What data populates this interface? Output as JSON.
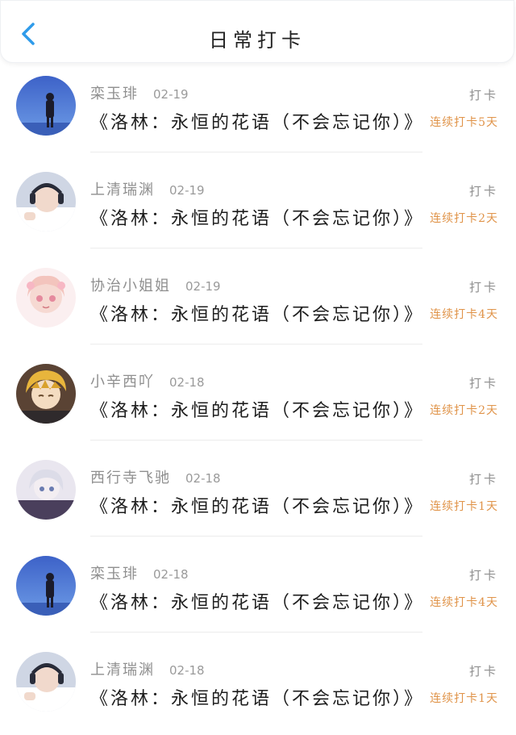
{
  "header": {
    "title": "日常打卡",
    "back_icon": "chevron-left-icon"
  },
  "colors": {
    "accent_blue": "#2f9bea",
    "streak_orange": "#e0944a",
    "muted_text": "#8f8f8f"
  },
  "entries": [
    {
      "username": "栾玉琲",
      "date": "02-19",
      "checkin_label": "打卡",
      "book_title": "《洛林：永恒的花语（不会忘记你）》",
      "streak": "连续打卡5天",
      "avatar": "blue-sky-silhouette-avatar"
    },
    {
      "username": "上清瑞渊",
      "date": "02-19",
      "checkin_label": "打卡",
      "book_title": "《洛林：永恒的花语（不会忘记你）》",
      "streak": "连续打卡2天",
      "avatar": "headphone-boy-avatar"
    },
    {
      "username": "协治小姐姐",
      "date": "02-19",
      "checkin_label": "打卡",
      "book_title": "《洛林：永恒的花语（不会忘记你）》",
      "streak": "连续打卡4天",
      "avatar": "pink-anime-girl-avatar"
    },
    {
      "username": "小辛西吖",
      "date": "02-18",
      "checkin_label": "打卡",
      "book_title": "《洛林：永恒的花语（不会忘记你）》",
      "streak": "连续打卡2天",
      "avatar": "blonde-anime-boy-avatar"
    },
    {
      "username": "西行寺飞驰",
      "date": "02-18",
      "checkin_label": "打卡",
      "book_title": "《洛林：永恒的花语（不会忘记你）》",
      "streak": "连续打卡1天",
      "avatar": "white-hair-anime-avatar"
    },
    {
      "username": "栾玉琲",
      "date": "02-18",
      "checkin_label": "打卡",
      "book_title": "《洛林：永恒的花语（不会忘记你）》",
      "streak": "连续打卡4天",
      "avatar": "blue-sky-silhouette-avatar"
    },
    {
      "username": "上清瑞渊",
      "date": "02-18",
      "checkin_label": "打卡",
      "book_title": "《洛林：永恒的花语（不会忘记你）》",
      "streak": "连续打卡1天",
      "avatar": "headphone-boy-avatar"
    }
  ]
}
